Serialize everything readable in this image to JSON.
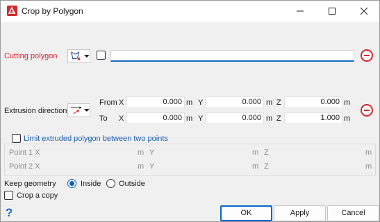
{
  "window": {
    "title": "Crop by Polygon"
  },
  "cutting_polygon": {
    "label": "Cutting polygon",
    "value": ""
  },
  "extrusion": {
    "label": "Extrusion direction",
    "from_label": "From",
    "to_label": "To",
    "x_label": "X",
    "y_label": "Y",
    "z_label": "Z",
    "unit": "m",
    "from": {
      "x": "0.000",
      "y": "0.000",
      "z": "0.000"
    },
    "to": {
      "x": "0.000",
      "y": "0.000",
      "z": "1.000"
    }
  },
  "limit": {
    "label": "Limit extruded polygon between two points",
    "point1_label": "Point 1 X",
    "point2_label": "Point 2 X",
    "y_label": "Y",
    "z_label": "Z",
    "unit": "m"
  },
  "keep_geometry": {
    "label": "Keep geometry",
    "options": [
      "Inside",
      "Outside"
    ],
    "selected": "Inside"
  },
  "crop_copy": {
    "label": "Crop a copy"
  },
  "buttons": {
    "ok": "OK",
    "apply": "Apply",
    "cancel": "Cancel"
  },
  "help": "?",
  "colors": {
    "required_label": "#e0202a",
    "accent": "#0a64c8",
    "remove": "#d8262e"
  }
}
